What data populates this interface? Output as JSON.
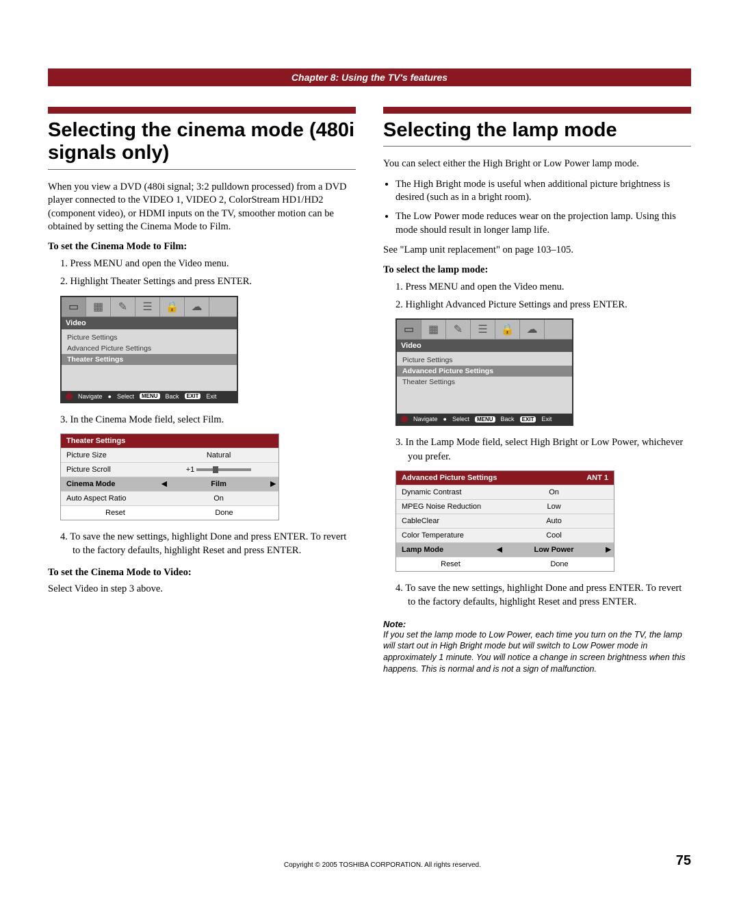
{
  "chapter": "Chapter 8: Using the TV's features",
  "left": {
    "title": "Selecting the cinema mode (480i signals only)",
    "intro": "When you view a DVD (480i signal; 3:2 pulldown processed) from a DVD player connected to the VIDEO 1, VIDEO 2, ColorStream HD1/HD2 (component video), or HDMI inputs on the TV, smoother motion can be obtained by setting the Cinema Mode to Film.",
    "to_set": "To set the Cinema Mode to Film:",
    "steps1": [
      "1.  Press MENU and open the Video menu.",
      "2.  Highlight Theater Settings and press ENTER."
    ],
    "menu": {
      "title": "Video",
      "items": [
        "Picture Settings",
        "Advanced Picture Settings",
        "Theater Settings"
      ],
      "selected": 2,
      "footer": {
        "nav": "Navigate",
        "sel": "Select",
        "back_btn": "MENU",
        "back": "Back",
        "exit_btn": "EXIT",
        "exit": "Exit"
      }
    },
    "step3": "3.  In the Cinema Mode field, select Film.",
    "table": {
      "header": "Theater Settings",
      "rows": [
        {
          "label": "Picture Size",
          "value": "Natural"
        },
        {
          "label": "Picture Scroll",
          "value_prefix": "+1",
          "slider": true
        },
        {
          "label": "Cinema Mode",
          "value": "Film",
          "highlight": true,
          "arrows": true
        },
        {
          "label": "Auto Aspect Ratio",
          "value": "On"
        }
      ],
      "actions": [
        "Reset",
        "Done"
      ]
    },
    "step4": "4.  To save the new settings, highlight Done and press ENTER. To revert to the factory defaults, highlight Reset and press ENTER.",
    "to_video": "To set the Cinema Mode to Video:",
    "to_video_body": "Select Video in step 3 above."
  },
  "right": {
    "title": "Selecting the lamp mode",
    "intro": "You can select either the High Bright or Low Power lamp mode.",
    "bullets": [
      "The High Bright mode is useful when additional picture brightness is desired (such as in a bright room).",
      "The Low Power mode reduces wear on the projection lamp. Using this mode should result in longer lamp life."
    ],
    "see": "See \"Lamp unit replacement\" on page 103–105.",
    "to_select": "To select the lamp mode:",
    "steps1": [
      "1.  Press MENU and open the Video menu.",
      "2.  Highlight Advanced Picture Settings and press ENTER."
    ],
    "menu": {
      "title": "Video",
      "items": [
        "Picture Settings",
        "Advanced Picture Settings",
        "Theater Settings"
      ],
      "selected": 1,
      "footer": {
        "nav": "Navigate",
        "sel": "Select",
        "back_btn": "MENU",
        "back": "Back",
        "exit_btn": "EXIT",
        "exit": "Exit"
      }
    },
    "step3": "3.  In the Lamp Mode field, select High Bright or Low Power, whichever you prefer.",
    "table": {
      "header": "Advanced Picture Settings",
      "header_right": "ANT 1",
      "rows": [
        {
          "label": "Dynamic Contrast",
          "value": "On"
        },
        {
          "label": "MPEG Noise Reduction",
          "value": "Low"
        },
        {
          "label": "CableClear",
          "value": "Auto"
        },
        {
          "label": "Color Temperature",
          "value": "Cool"
        },
        {
          "label": "Lamp Mode",
          "value": "Low Power",
          "highlight": true,
          "arrows": true
        }
      ],
      "actions": [
        "Reset",
        "Done"
      ]
    },
    "step4": "4.  To save the new settings, highlight Done and press ENTER. To revert to the factory defaults, highlight Reset and press ENTER.",
    "note_head": "Note:",
    "note": "If you set the lamp mode to Low Power, each time you turn on the TV, the lamp will start out in High Bright mode but will switch to Low Power mode in approximately 1 minute. You will notice a change in screen brightness when this happens. This is normal and is not a sign of malfunction."
  },
  "footer": {
    "copy": "Copyright © 2005 TOSHIBA CORPORATION. All rights reserved.",
    "page": "75"
  },
  "icons": {
    "t1": "▭",
    "t2": "▦",
    "t3": "✎",
    "t4": "☰",
    "t5": "🔒",
    "t6": "☁"
  }
}
